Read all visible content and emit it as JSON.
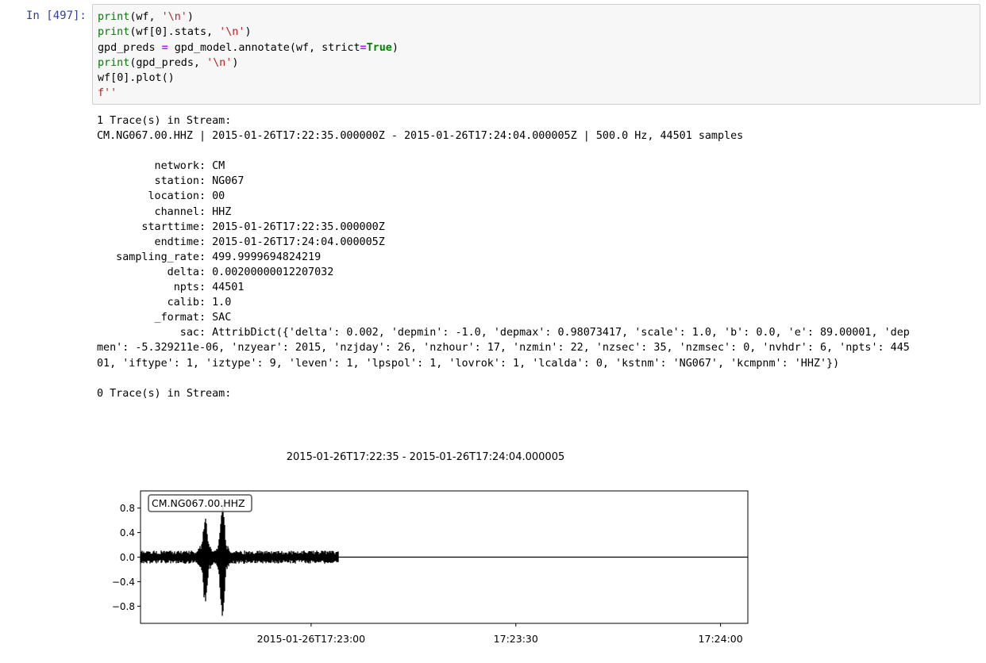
{
  "cell": {
    "prompt": "In [497]:",
    "code_lines": [
      [
        {
          "t": "print",
          "c": "kw-fn"
        },
        {
          "t": "(wf, "
        },
        {
          "t": "'\\n'",
          "c": "str"
        },
        {
          "t": ")"
        }
      ],
      [
        {
          "t": "print",
          "c": "kw-fn"
        },
        {
          "t": "(wf["
        },
        {
          "t": "0"
        },
        {
          "t": "].stats, "
        },
        {
          "t": "'\\n'",
          "c": "str"
        },
        {
          "t": ")"
        }
      ],
      [
        {
          "t": "gpd_preds "
        },
        {
          "t": "=",
          "c": "op"
        },
        {
          "t": " gpd_model.annotate(wf, strict"
        },
        {
          "t": "=",
          "c": "op"
        },
        {
          "t": "True",
          "c": "kw-const"
        },
        {
          "t": ")"
        }
      ],
      [
        {
          "t": "print",
          "c": "kw-fn"
        },
        {
          "t": "(gpd_preds, "
        },
        {
          "t": "'\\n'",
          "c": "str"
        },
        {
          "t": ")"
        }
      ],
      [
        {
          "t": "wf["
        },
        {
          "t": "0"
        },
        {
          "t": "].plot()"
        }
      ],
      [
        {
          "t": "f''",
          "c": "str"
        }
      ]
    ]
  },
  "output": {
    "lines": [
      "1 Trace(s) in Stream:",
      "CM.NG067.00.HHZ | 2015-01-26T17:22:35.000000Z - 2015-01-26T17:24:04.000005Z | 500.0 Hz, 44501 samples",
      "",
      "         network: CM",
      "         station: NG067",
      "        location: 00",
      "         channel: HHZ",
      "       starttime: 2015-01-26T17:22:35.000000Z",
      "         endtime: 2015-01-26T17:24:04.000005Z",
      "   sampling_rate: 499.9999694824219",
      "           delta: 0.00200000012207032",
      "            npts: 44501",
      "           calib: 1.0",
      "         _format: SAC",
      "             sac: AttribDict({'delta': 0.002, 'depmin': -1.0, 'depmax': 0.98073417, 'scale': 1.0, 'b': 0.0, 'e': 89.00001, 'dep",
      "men': -5.329211e-06, 'nzyear': 2015, 'nzjday': 26, 'nzhour': 17, 'nzmin': 22, 'nzsec': 35, 'nzmsec': 0, 'nvhdr': 6, 'npts': 445",
      "01, 'iftype': 1, 'iztype': 9, 'leven': 1, 'lpspol': 1, 'lovrok': 1, 'lcalda': 0, 'kstnm': 'NG067', 'kcmpnm': 'HHZ'})",
      "",
      "0 Trace(s) in Stream:"
    ]
  },
  "chart_data": {
    "type": "line",
    "title": "2015-01-26T17:22:35  -  2015-01-26T17:24:04.000005",
    "trace_label": "CM.NG067.00.HHZ",
    "xlabel": "",
    "ylabel": "",
    "x_unit": "seconds after 2015-01-26T17:22:35",
    "xlim": [
      0,
      89
    ],
    "ylim": [
      -1.08,
      1.08
    ],
    "x_ticks": [
      {
        "value": 25,
        "label": "2015-01-26T17:23:00"
      },
      {
        "value": 55,
        "label": "17:23:30"
      },
      {
        "value": 85,
        "label": "17:24:00"
      }
    ],
    "y_ticks": [
      {
        "value": 0.8,
        "label": "0.8"
      },
      {
        "value": 0.4,
        "label": "0.4"
      },
      {
        "value": 0.0,
        "label": "0.0"
      },
      {
        "value": -0.4,
        "label": "−0.4"
      },
      {
        "value": -0.8,
        "label": "−0.8"
      }
    ],
    "line_color": "#000000",
    "series": [
      {
        "noise_until": 29.0,
        "noise_amplitude": 0.09,
        "bursts": [
          {
            "t": 9.5,
            "max": 0.72,
            "min": -0.8
          },
          {
            "t": 12.0,
            "max": 0.98,
            "min": -1.0
          }
        ],
        "flat_after": 29.0,
        "flat_value": 0.0
      }
    ]
  }
}
